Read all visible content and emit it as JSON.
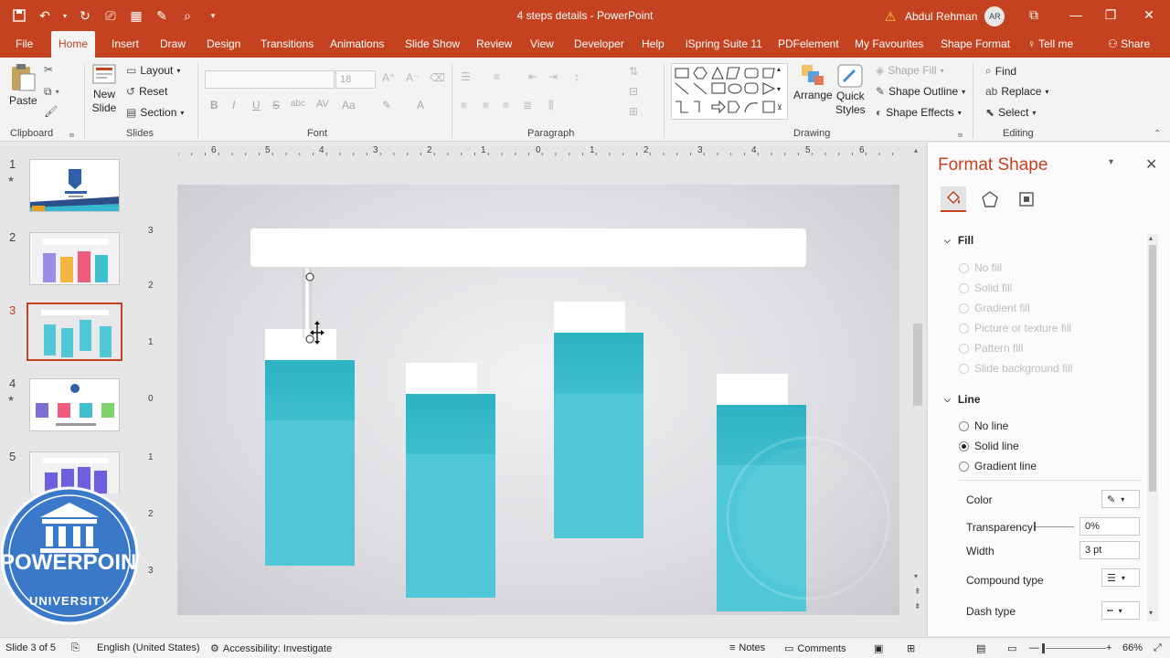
{
  "window": {
    "title": "4 steps details  -  PowerPoint",
    "user_name": "Abdul Rehman",
    "user_initials": "AR"
  },
  "tabs": [
    "File",
    "Home",
    "Insert",
    "Draw",
    "Design",
    "Transitions",
    "Animations",
    "Slide Show",
    "Review",
    "View",
    "Developer",
    "Help",
    "iSpring Suite 11",
    "PDFelement",
    "My Favourites",
    "Shape Format",
    "Tell me",
    "Share"
  ],
  "ribbon": {
    "clipboard": {
      "paste": "Paste",
      "label": "Clipboard"
    },
    "slides": {
      "new_slide_1": "New",
      "new_slide_2": "Slide",
      "layout": "Layout",
      "reset": "Reset",
      "section": "Section",
      "label": "Slides"
    },
    "font": {
      "size": "18",
      "label": "Font"
    },
    "paragraph": {
      "label": "Paragraph"
    },
    "drawing": {
      "arrange": "Arrange",
      "quick_styles_1": "Quick",
      "quick_styles_2": "Styles",
      "shape_fill": "Shape Fill",
      "shape_outline": "Shape Outline",
      "shape_effects": "Shape Effects",
      "label": "Drawing"
    },
    "editing": {
      "find": "Find",
      "replace": "Replace",
      "select": "Select",
      "label": "Editing"
    }
  },
  "slides_pane": {
    "numbers": [
      "1",
      "2",
      "3",
      "4",
      "5"
    ],
    "star": "★",
    "selected_index": 3
  },
  "rulers": {
    "horizontal": [
      "6",
      "5",
      "4",
      "3",
      "2",
      "1",
      "0",
      "1",
      "2",
      "3",
      "4",
      "5",
      "6"
    ],
    "vertical": [
      "3",
      "2",
      "1",
      "0",
      "1",
      "2",
      "3"
    ]
  },
  "format_pane": {
    "title": "Format Shape",
    "fill_section": "Fill",
    "fill_options": [
      "No fill",
      "Solid fill",
      "Gradient fill",
      "Picture or texture fill",
      "Pattern fill",
      "Slide background fill"
    ],
    "line_section": "Line",
    "line_options": [
      "No line",
      "Solid line",
      "Gradient line"
    ],
    "line_selected": "Solid line",
    "color_label": "Color",
    "transparency_label": "Transparency",
    "transparency_value": "0%",
    "width_label": "Width",
    "width_value": "3 pt",
    "compound_label": "Compound type",
    "dash_label": "Dash type"
  },
  "status": {
    "slide_info": "Slide 3 of 5",
    "language": "English (United States)",
    "accessibility": "Accessibility: Investigate",
    "notes": "Notes",
    "comments": "Comments",
    "zoom": "66%"
  },
  "watermark": {
    "line1": "POWERPOINT",
    "line2": "UNIVERSITY"
  },
  "colors": {
    "accent": "#c4421f",
    "bar": "#4fc7d6",
    "bar_top": "#2cb3c4",
    "logo_blue": "#3a78c9"
  }
}
